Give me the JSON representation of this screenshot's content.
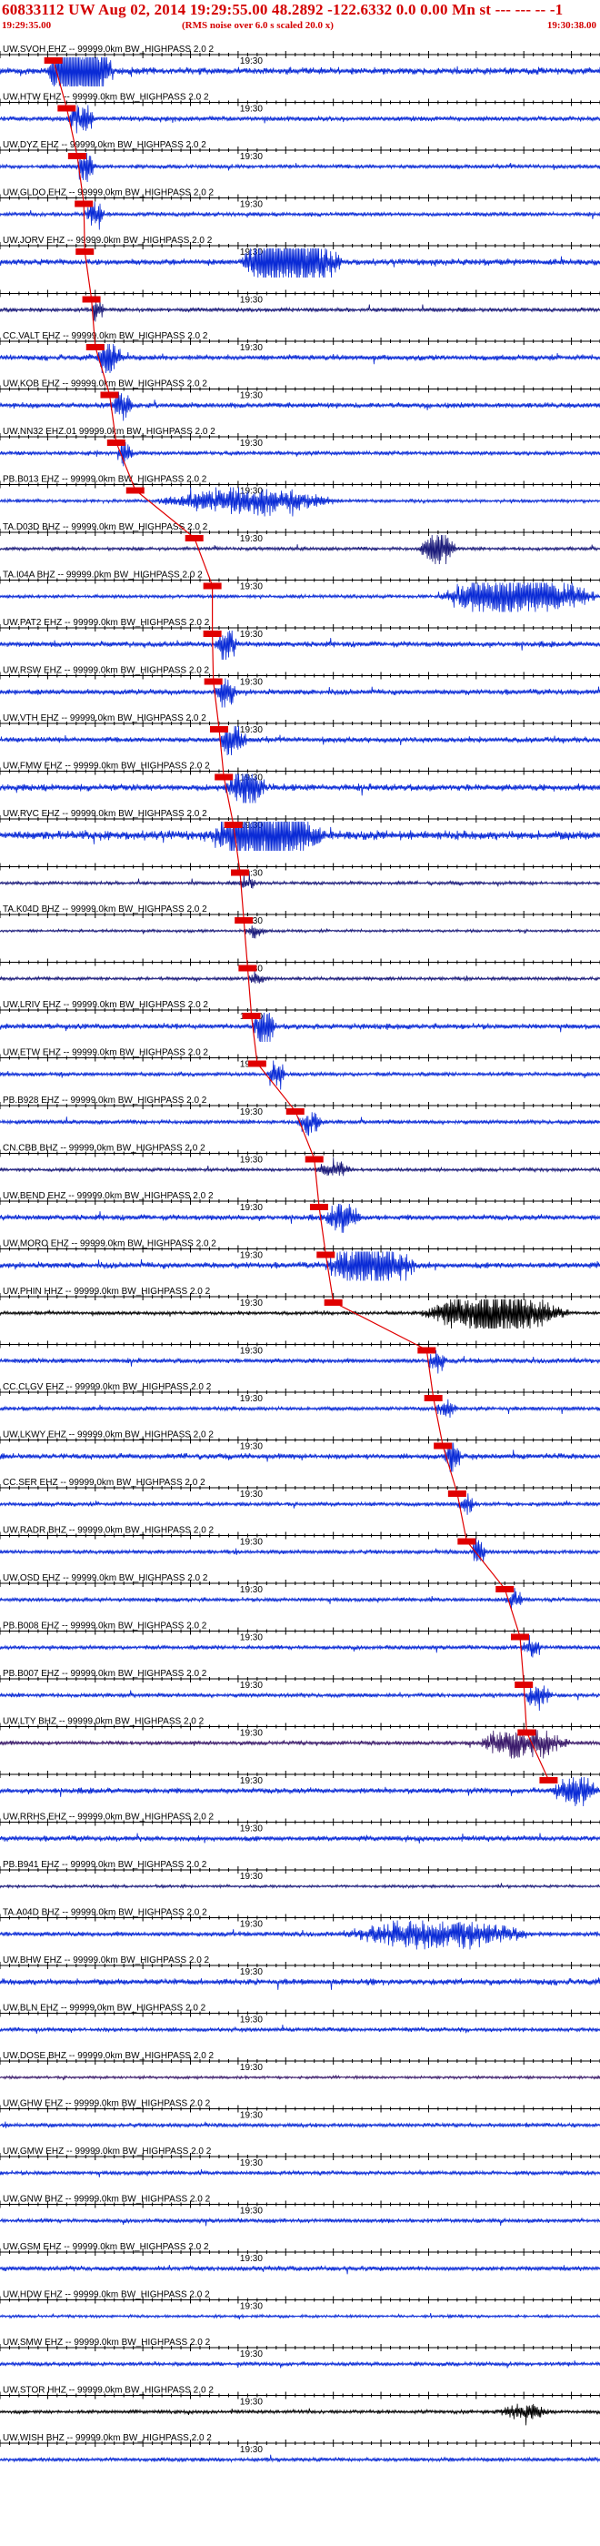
{
  "header": {
    "title": "60833112 UW Aug 02, 2014 19:29:55.00   48.2892 -122.6332  0.0 0.00 Mn st --- --- --  -1",
    "start_time": "19:29:35.00",
    "note": "(RMS noise over 6.0 s scaled 20.0 x)",
    "end_time": "19:30:38.00"
  },
  "chart_data": {
    "type": "line",
    "title": "60833112 UW Aug 02, 2014 19:29:55.00   48.2892 -122.6332  0.0 0.00 Mn st --- --- --  -1",
    "xlabel": "",
    "ylabel": "",
    "x_range_seconds": [
      0,
      63
    ],
    "tick_interval_seconds": 1,
    "time_label": "19:30",
    "time_label_second": 25,
    "colors": {
      "title": "#d40000",
      "trace_blue": "#0a2bd6",
      "trace_navy": "#1a1a7a",
      "trace_purple": "#3a1a6a",
      "trace_black": "#000000",
      "pick_box": "#e00000",
      "axis": "#000000"
    },
    "traces": [
      {
        "label": "UW.SVOH EHZ -- 99999.0km BW_HIGHPASS  2.0  2",
        "pick": "",
        "pick_second": 5.6,
        "color": "trace_blue",
        "amp": 1.0,
        "burst": [
          5.0,
          12.0,
          6.0
        ]
      },
      {
        "label": "UW.HTW EHZ -- 99999.0km BW_HIGHPASS  2.0  2",
        "pick": "",
        "pick_second": 7.0,
        "color": "trace_blue",
        "amp": 0.7,
        "burst": [
          7.0,
          10.0,
          2.5
        ]
      },
      {
        "label": "UW.DYZ EHZ -- 99999.0km BW_HIGHPASS  2.0  2",
        "pick": "",
        "pick_second": 8.1,
        "color": "trace_blue",
        "amp": 0.6,
        "burst": [
          8.0,
          10.0,
          3.0
        ]
      },
      {
        "label": "UW.GLDO EHZ -- 99999.0km BW_HIGHPASS  2.0  2",
        "pick": "",
        "pick_second": 8.8,
        "color": "trace_blue",
        "amp": 0.6,
        "burst": [
          8.8,
          11.0,
          2.5
        ]
      },
      {
        "label": "UW.JORV EHZ -- 99999.0km BW_HIGHPASS  2.0  2",
        "pick": "",
        "pick_second": 8.9,
        "color": "trace_blue",
        "amp": 0.9,
        "burst": [
          25.0,
          36.0,
          4.0
        ]
      },
      {
        "label": "",
        "pick": "",
        "pick_second": 9.6,
        "color": "trace_navy",
        "amp": 0.6,
        "burst": [
          9.5,
          11.0,
          1.8
        ]
      },
      {
        "label": "CC.VALT EHZ -- 99999.0km BW_HIGHPASS  2.0  2",
        "pick": "",
        "pick_second": 10.0,
        "color": "trace_blue",
        "amp": 0.8,
        "burst": [
          10.0,
          13.0,
          2.5
        ]
      },
      {
        "label": "UW.KOB EHZ -- 99999.0km BW_HIGHPASS  2.0  2",
        "pick": "",
        "pick_second": 11.5,
        "color": "trace_blue",
        "amp": 0.8,
        "burst": [
          11.5,
          14.0,
          2.0
        ]
      },
      {
        "label": "UW.NN32 EHZ.01 99999.0km BW_HIGHPASS  2.0  2",
        "pick": "",
        "pick_second": 12.2,
        "color": "trace_blue",
        "amp": 0.6,
        "burst": [
          12.2,
          14.0,
          2.0
        ]
      },
      {
        "label": "PB.B013 EHZ -- 99999.0km BW_HIGHPASS  2.0  2",
        "pick": "",
        "pick_second": 14.2,
        "color": "trace_blue",
        "amp": 0.5,
        "burst": [
          16.0,
          36.0,
          2.5
        ]
      },
      {
        "label": "TA.D03D BHZ -- 99999.0km BW_HIGHPASS  2.0  2",
        "pick": "",
        "pick_second": 20.4,
        "color": "trace_navy",
        "amp": 0.5,
        "burst": [
          44.0,
          48.0,
          4.0
        ]
      },
      {
        "label": "TA.I04A BHZ -- 99999.0km BW_HIGHPASS  2.0  2",
        "pick": "",
        "pick_second": 22.3,
        "color": "trace_blue",
        "amp": 0.5,
        "burst": [
          46.0,
          63.0,
          5.0
        ]
      },
      {
        "label": "UW.PAT2 EHZ -- 99999.0km BW_HIGHPASS  2.0  2",
        "pick": "",
        "pick_second": 22.3,
        "color": "trace_blue",
        "amp": 0.8,
        "burst": [
          22.5,
          25.0,
          2.0
        ]
      },
      {
        "label": "UW.RSW EHZ -- 99999.0km BW_HIGHPASS  2.0  2",
        "pick": "",
        "pick_second": 22.4,
        "color": "trace_blue",
        "amp": 0.8,
        "burst": [
          22.4,
          25.0,
          2.0
        ]
      },
      {
        "label": "UW.VTH EHZ -- 99999.0km BW_HIGHPASS  2.0  2",
        "pick": "",
        "pick_second": 23.0,
        "color": "trace_blue",
        "amp": 0.8,
        "burst": [
          23.0,
          26.0,
          2.0
        ]
      },
      {
        "label": "UW.FMW EHZ -- 99999.0km BW_HIGHPASS  2.0  2",
        "pick": "",
        "pick_second": 23.5,
        "color": "trace_blue",
        "amp": 1.0,
        "burst": [
          23.5,
          28.0,
          2.0
        ]
      },
      {
        "label": "UW.RVC EHZ -- 99999.0km BW_HIGHPASS  2.0  2",
        "pick": "",
        "pick_second": 24.5,
        "color": "trace_blue",
        "amp": 1.3,
        "burst": [
          22.0,
          34.0,
          3.0
        ]
      },
      {
        "label": "",
        "pick": "",
        "pick_second": 25.2,
        "color": "trace_navy",
        "amp": 0.5,
        "burst": [
          25.0,
          27.0,
          1.5
        ]
      },
      {
        "label": "TA.K04D BHZ -- 99999.0km BW_HIGHPASS  2.0  2",
        "pick": "",
        "pick_second": 25.6,
        "color": "trace_navy",
        "amp": 0.4,
        "burst": [
          25.6,
          28.0,
          1.5
        ]
      },
      {
        "label": "",
        "pick": "",
        "pick_second": 26.0,
        "color": "trace_navy",
        "amp": 0.5,
        "burst": [
          26.0,
          28.0,
          1.5
        ]
      },
      {
        "label": "UW.LRIV EHZ -- 99999.0km BW_HIGHPASS  2.0  2",
        "pick": "",
        "pick_second": 26.4,
        "color": "trace_blue",
        "amp": 0.8,
        "burst": [
          26.5,
          29.0,
          3.0
        ]
      },
      {
        "label": "UW.ETW EHZ -- 99999.0km BW_HIGHPASS  2.0  2",
        "pick": "",
        "pick_second": 27.0,
        "color": "trace_blue",
        "amp": 0.6,
        "burst": [
          28.0,
          30.0,
          2.5
        ]
      },
      {
        "label": "PB.B928 EHZ -- 99999.0km BW_HIGHPASS  2.0  2",
        "pick": "",
        "pick_second": 31.0,
        "color": "trace_blue",
        "amp": 0.6,
        "burst": [
          31.0,
          34.0,
          2.0
        ]
      },
      {
        "label": "CN.CBB BHZ -- 99999.0km BW_HIGHPASS  2.0  2",
        "pick": "",
        "pick_second": 33.0,
        "color": "trace_navy",
        "amp": 0.5,
        "burst": [
          33.0,
          37.0,
          1.8
        ]
      },
      {
        "label": "UW.BEND EHZ -- 99999.0km BW_HIGHPASS  2.0  2",
        "pick": "",
        "pick_second": 33.5,
        "color": "trace_blue",
        "amp": 0.8,
        "burst": [
          34.0,
          38.0,
          2.0
        ]
      },
      {
        "label": "UW.MORO EHZ -- 99999.0km BW_HIGHPASS  2.0  2",
        "pick": "",
        "pick_second": 34.2,
        "color": "trace_blue",
        "amp": 0.9,
        "burst": [
          34.0,
          44.0,
          3.0
        ]
      },
      {
        "label": "UW.PHIN HHZ -- 99999.0km BW_HIGHPASS  2.0  2",
        "pick": "",
        "pick_second": 35.0,
        "color": "trace_black",
        "amp": 0.5,
        "burst": [
          44.0,
          60.0,
          5.0
        ]
      },
      {
        "label": "",
        "pick": "",
        "pick_second": 44.8,
        "color": "trace_blue",
        "amp": 0.7,
        "burst": [
          44.8,
          47.0,
          1.5
        ]
      },
      {
        "label": "CC.CLGV EHZ -- 99999.0km BW_HIGHPASS  2.0  2",
        "pick": "",
        "pick_second": 45.5,
        "color": "trace_blue",
        "amp": 0.6,
        "burst": [
          45.5,
          48.0,
          1.5
        ]
      },
      {
        "label": "UW.LKWY EHZ -- 99999.0km BW_HIGHPASS  2.0  2",
        "pick": "",
        "pick_second": 46.5,
        "color": "trace_blue",
        "amp": 0.8,
        "burst": [
          46.5,
          48.5,
          2.5
        ]
      },
      {
        "label": "CC.SER EHZ -- 99999.0km BW_HIGHPASS  2.0  2",
        "pick": "",
        "pick_second": 48.0,
        "color": "trace_blue",
        "amp": 0.6,
        "burst": [
          48.0,
          50.0,
          1.5
        ]
      },
      {
        "label": "UW.RADR BHZ -- 99999.0km BW_HIGHPASS  2.0  2",
        "pick": "",
        "pick_second": 49.0,
        "color": "trace_blue",
        "amp": 0.6,
        "burst": [
          49.5,
          51.0,
          3.0
        ]
      },
      {
        "label": "UW.OSD EHZ -- 99999.0km BW_HIGHPASS  2.0  2",
        "pick": "",
        "pick_second": 53.0,
        "color": "trace_blue",
        "amp": 0.6,
        "burst": [
          53.0,
          55.0,
          1.5
        ]
      },
      {
        "label": "PB.B008 EHZ -- 99999.0km BW_HIGHPASS  2.0  2",
        "pick": "",
        "pick_second": 54.6,
        "color": "trace_blue",
        "amp": 0.6,
        "burst": [
          54.6,
          57.0,
          1.5
        ]
      },
      {
        "label": "PB.B007 EHZ -- 99999.0km BW_HIGHPASS  2.0  2",
        "pick": "",
        "pick_second": 55.0,
        "color": "trace_blue",
        "amp": 0.6,
        "burst": [
          55.0,
          58.0,
          2.0
        ]
      },
      {
        "label": "UW.LTY BHZ -- 99999.0km BW_HIGHPASS  2.0  2",
        "pick": "",
        "pick_second": 55.3,
        "color": "trace_purple",
        "amp": 0.6,
        "burst": [
          50.0,
          60.0,
          2.5
        ]
      },
      {
        "label": "",
        "pick": "",
        "pick_second": 57.6,
        "color": "trace_blue",
        "amp": 0.8,
        "burst": [
          57.6,
          63.0,
          2.0
        ]
      },
      {
        "label": "UW.RRHS EHZ -- 99999.0km BW_HIGHPASS  2.0  2",
        "pick": "",
        "pick_second": -1,
        "color": "trace_blue",
        "amp": 0.8,
        "burst": []
      },
      {
        "label": "PB.B941 EHZ -- 99999.0km BW_HIGHPASS  2.0  2",
        "pick": "",
        "pick_second": -1,
        "color": "trace_navy",
        "amp": 0.4,
        "burst": []
      },
      {
        "label": "TA.A04D BHZ -- 99999.0km BW_HIGHPASS  2.0  2",
        "pick": "",
        "pick_second": -1,
        "color": "trace_blue",
        "amp": 0.7,
        "burst": [
          36.0,
          56.0,
          1.8
        ]
      },
      {
        "label": "UW.BHW EHZ -- 99999.0km BW_HIGHPASS  2.0  2",
        "pick": "",
        "pick_second": -1,
        "color": "trace_blue",
        "amp": 0.9,
        "burst": []
      },
      {
        "label": "UW.BLN EHZ -- 99999.0km BW_HIGHPASS  2.0  2",
        "pick": "",
        "pick_second": -1,
        "color": "trace_blue",
        "amp": 0.6,
        "burst": []
      },
      {
        "label": "UW.DOSE BHZ -- 99999.0km BW_HIGHPASS  2.0  2",
        "pick": "",
        "pick_second": -1,
        "color": "trace_purple",
        "amp": 0.4,
        "burst": []
      },
      {
        "label": "UW.GHW EHZ -- 99999.0km BW_HIGHPASS  2.0  2",
        "pick": "",
        "pick_second": -1,
        "color": "trace_blue",
        "amp": 0.6,
        "burst": []
      },
      {
        "label": "UW.GMW EHZ -- 99999.0km BW_HIGHPASS  2.0  2",
        "pick": "",
        "pick_second": -1,
        "color": "trace_blue",
        "amp": 0.6,
        "burst": []
      },
      {
        "label": "UW.GNW BHZ -- 99999.0km BW_HIGHPASS  2.0  2",
        "pick": "",
        "pick_second": -1,
        "color": "trace_blue",
        "amp": 0.6,
        "burst": []
      },
      {
        "label": "UW.GSM EHZ -- 99999.0km BW_HIGHPASS  2.0  2",
        "pick": "",
        "pick_second": -1,
        "color": "trace_blue",
        "amp": 0.7,
        "burst": []
      },
      {
        "label": "UW.HDW EHZ -- 99999.0km BW_HIGHPASS  2.0  2",
        "pick": "",
        "pick_second": -1,
        "color": "trace_blue",
        "amp": 0.4,
        "burst": []
      },
      {
        "label": "UW.SMW EHZ -- 99999.0km BW_HIGHPASS  2.0  2",
        "pick": "",
        "pick_second": -1,
        "color": "trace_blue",
        "amp": 0.6,
        "burst": []
      },
      {
        "label": "UW.STOR HHZ -- 99999.0km BW_HIGHPASS  2.0  2",
        "pick": "",
        "pick_second": -1,
        "color": "trace_black",
        "amp": 0.5,
        "burst": [
          52.0,
          58.0,
          1.4
        ]
      },
      {
        "label": "UW.WISH BHZ -- 99999.0km BW_HIGHPASS  2.0  2",
        "pick": "",
        "pick_second": -1,
        "color": "trace_blue",
        "amp": 0.6,
        "burst": []
      }
    ]
  }
}
